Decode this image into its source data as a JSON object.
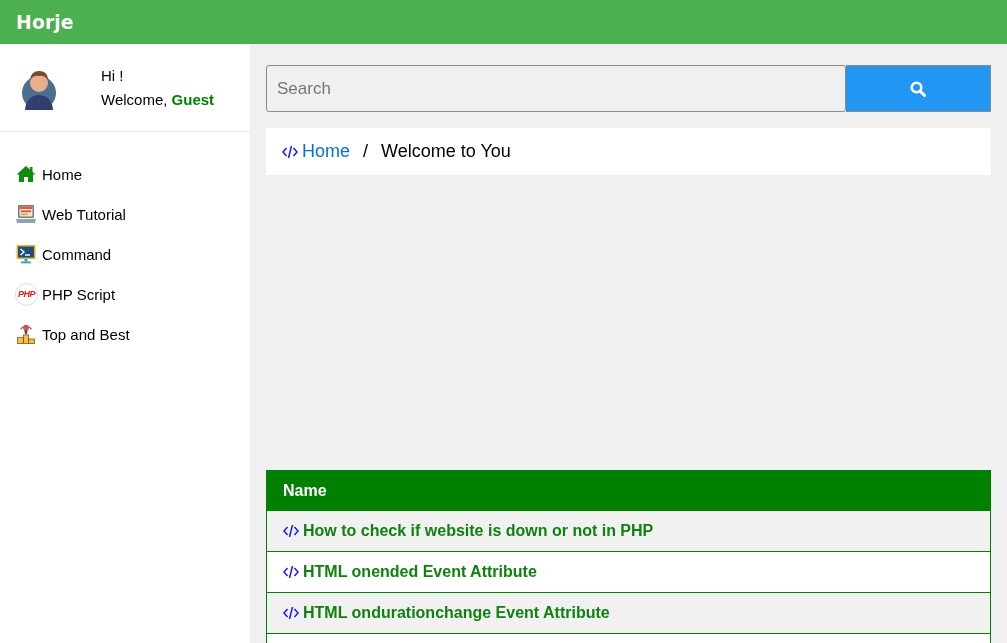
{
  "header": {
    "logo": "Horje"
  },
  "profile": {
    "greeting": "Hi !",
    "welcome": "Welcome, **Guest**"
  },
  "sidebar": {
    "items": [
      {
        "label": "Home",
        "kind": "home"
      },
      {
        "label": "Web Tutorial",
        "kind": "laptop"
      },
      {
        "label": "Command",
        "kind": "terminal"
      },
      {
        "label": "PHP Script",
        "kind": "badge",
        "badge": "PHP"
      },
      {
        "label": "Top and Best",
        "kind": "podium"
      }
    ]
  },
  "search": {
    "placeholder": "Search"
  },
  "breadcrumb": {
    "items": [
      {
        "label": "Home",
        "kind": "link"
      },
      {
        "label": "Welcome to You",
        "kind": "current"
      }
    ],
    "separator": "/"
  },
  "table": {
    "columns": [
      "Name"
    ],
    "rows": [
      {
        "title": "How to check if website is down or not in PHP"
      },
      {
        "title": "HTML onended Event Attribute"
      },
      {
        "title": "HTML ondurationchange Event Attribute"
      }
    ]
  }
}
